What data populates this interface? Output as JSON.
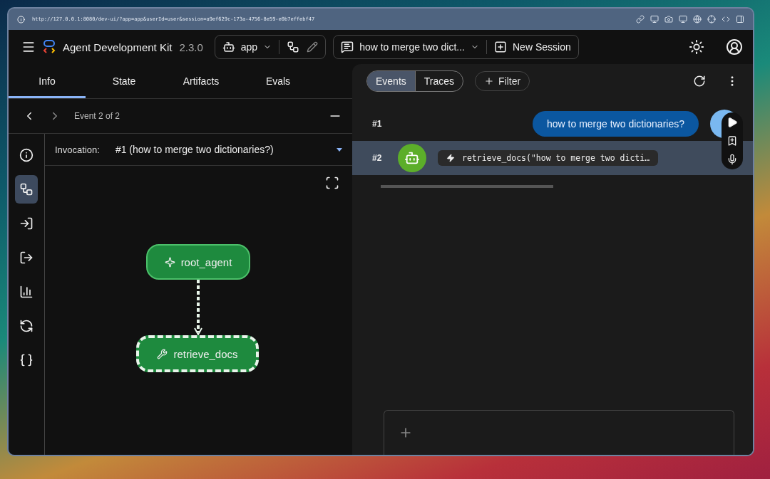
{
  "browser": {
    "url": "http://127.0.0.1:8080/dev-ui/?app=app&userId=user&session=a9ef629c-173a-4756-8e59-e0b7effebf47"
  },
  "header": {
    "title": "Agent Development Kit",
    "version": "2.3.0",
    "app": "app",
    "session": "how to merge two dict...",
    "new_session": "New Session"
  },
  "tabs": [
    {
      "label": "Info",
      "selected": true
    },
    {
      "label": "State",
      "selected": false
    },
    {
      "label": "Artifacts",
      "selected": false
    },
    {
      "label": "Evals",
      "selected": false
    }
  ],
  "event_nav": {
    "label": "Event 2 of 2"
  },
  "side_rail": [
    {
      "kind": "info",
      "selected": false
    },
    {
      "kind": "graph",
      "selected": true
    },
    {
      "kind": "request",
      "selected": false
    },
    {
      "kind": "response",
      "selected": false
    },
    {
      "kind": "metrics",
      "selected": false
    },
    {
      "kind": "eval",
      "selected": false
    },
    {
      "kind": "json",
      "selected": false
    }
  ],
  "invocation": {
    "label": "Invocation:",
    "value": "#1 (how to merge two dictionaries?)"
  },
  "graph": {
    "nodes": [
      {
        "kind": "agent",
        "label": "root_agent",
        "highlighted": false
      },
      {
        "kind": "tool",
        "label": "retrieve_docs",
        "highlighted": true
      }
    ]
  },
  "view_toggle": [
    {
      "label": "Events",
      "selected": true
    },
    {
      "label": "Traces",
      "selected": false
    }
  ],
  "filter": {
    "label": "Filter"
  },
  "events": [
    {
      "kind": "user",
      "index": "#1",
      "text": "how to merge two dictionaries?",
      "selected": false
    },
    {
      "kind": "call",
      "index": "#2",
      "text": "retrieve_docs(\"how to merge two dicti…",
      "selected": true
    }
  ]
}
